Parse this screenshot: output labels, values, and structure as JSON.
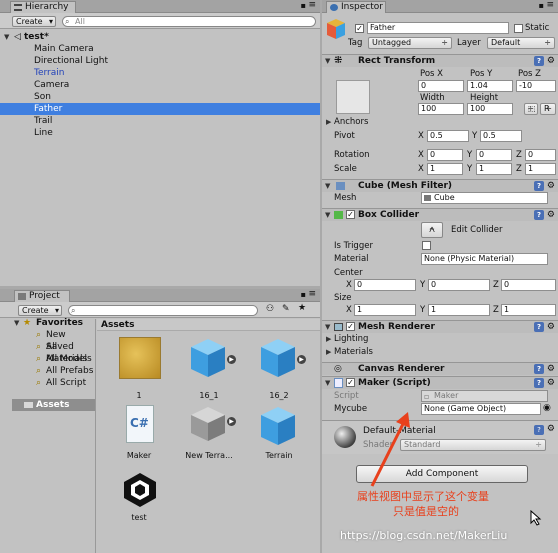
{
  "hierarchy": {
    "tab_label": "Hierarchy",
    "create_label": "Create",
    "search_placeholder": "All",
    "scene_name": "test*",
    "items": [
      "Main Camera",
      "Directional Light",
      "Terrain",
      "Camera",
      "Son",
      "Father",
      "Trail",
      "Line"
    ]
  },
  "project": {
    "tab_label": "Project",
    "create_label": "Create",
    "favorites_label": "Favorites",
    "favorites": [
      "New Saved",
      "All Materials",
      "All Models",
      "All Prefabs",
      "All Script"
    ],
    "assets_label": "Assets",
    "assets_header": "Assets",
    "assets": [
      {
        "name": "1",
        "kind": "material"
      },
      {
        "name": "16_1",
        "kind": "prefab"
      },
      {
        "name": "16_2",
        "kind": "prefab"
      },
      {
        "name": "Maker",
        "kind": "script",
        "glyph": "C#"
      },
      {
        "name": "New Terra...",
        "kind": "terrain"
      },
      {
        "name": "Terrain",
        "kind": "prefab"
      },
      {
        "name": "test",
        "kind": "unity-scene"
      }
    ]
  },
  "inspector": {
    "tab_label": "Inspector",
    "object_name": "Father",
    "static_label": "Static",
    "tag_label": "Tag",
    "tag_value": "Untagged",
    "layer_label": "Layer",
    "layer_value": "Default",
    "rect_transform": {
      "title": "Rect Transform",
      "pos_x_label": "Pos X",
      "pos_y_label": "Pos Y",
      "pos_z_label": "Pos Z",
      "pos_x": "0",
      "pos_y": "1.04",
      "pos_z": "-10",
      "width_label": "Width",
      "height_label": "Height",
      "width": "100",
      "height": "100",
      "r_label": "R",
      "anchors_label": "Anchors",
      "pivot_label": "Pivot",
      "pivot_x": "0.5",
      "pivot_y": "0.5",
      "rotation_label": "Rotation",
      "rot_x": "0",
      "rot_y": "0",
      "rot_z": "0",
      "scale_label": "Scale",
      "scale_x": "1",
      "scale_y": "1",
      "scale_z": "1"
    },
    "mesh_filter": {
      "title": "Cube (Mesh Filter)",
      "mesh_label": "Mesh",
      "mesh_value": "Cube"
    },
    "box_collider": {
      "title": "Box Collider",
      "edit_label": "Edit Collider",
      "is_trigger_label": "Is Trigger",
      "material_label": "Material",
      "material_value": "None (Physic Material)",
      "center_label": "Center",
      "cx": "0",
      "cy": "0",
      "cz": "0",
      "size_label": "Size",
      "sx": "1",
      "sy": "1",
      "sz": "1"
    },
    "mesh_renderer": {
      "title": "Mesh Renderer",
      "lighting_label": "Lighting",
      "materials_label": "Materials"
    },
    "canvas_renderer": {
      "title": "Canvas Renderer"
    },
    "maker_script": {
      "title": "Maker (Script)",
      "script_label": "Script",
      "script_value": "Maker",
      "mycube_label": "Mycube",
      "mycube_value": "None (Game Object)"
    },
    "material": {
      "name": "Default-Material",
      "shader_label": "Shader",
      "shader_value": "Standard"
    },
    "add_component_label": "Add Component"
  },
  "annotation": {
    "line1": "属性视图中显示了这个变量",
    "line2": "只是值是空的",
    "color": "#e8401c"
  },
  "watermark": "https://blog.csdn.net/MakerLiu",
  "colors": {
    "selection": "#3f7fe0",
    "link_blue": "#2343b9",
    "panel": "#c2c2c2"
  }
}
